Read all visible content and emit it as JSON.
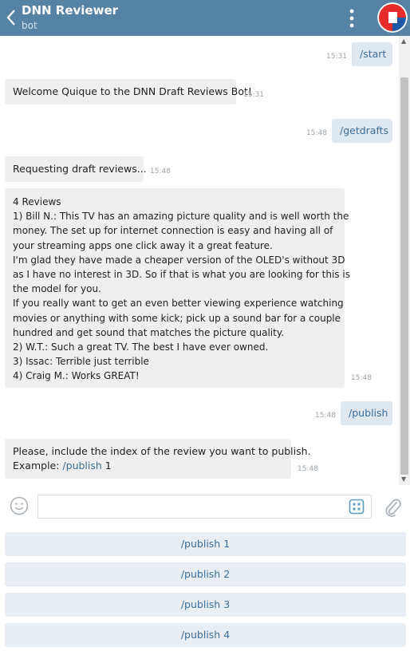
{
  "header": {
    "title": "DNN Reviewer",
    "subtitle": "bot"
  },
  "messages": [
    {
      "direction": "out",
      "text": "/start",
      "time": "15:31"
    },
    {
      "direction": "in",
      "text": "Welcome Quique to the DNN Draft Reviews Bot!",
      "time": "15:31"
    },
    {
      "direction": "out",
      "text": "/getdrafts",
      "time": "15:48"
    },
    {
      "direction": "in",
      "text": "Requesting draft reviews...",
      "time": "15:48"
    },
    {
      "direction": "in",
      "lines": [
        "4 Reviews",
        "1) Bill N.: This TV has an amazing picture quality and is well worth the",
        "money. The set up for internet connection is easy and having all of",
        "your streaming apps one click away it a great feature.",
        "I'm glad they have made a cheaper version of the OLED's without 3D",
        "as I have no interest in 3D. So if that is what you are looking for this is",
        "the model for you.",
        "If you really want to get an even better viewing experience watching",
        "movies or anything with some kick; pick up a sound bar for a couple",
        "hundred and get sound that matches the picture quality.",
        "2) W.T.: Such a great TV. The best I have ever owned.",
        "3) Issac: Terrible just terrible",
        "4) Craig M.: Works GREAT!"
      ],
      "time": "15:48"
    },
    {
      "direction": "out",
      "text": "/publish",
      "time": "15:48"
    },
    {
      "direction": "in",
      "line1": "Please, include the index of the review you want to publish.",
      "example_label": "Example: ",
      "example_cmd": "/publish",
      "example_arg": " 1",
      "time": "15:48"
    }
  ],
  "composer": {
    "placeholder": ""
  },
  "keyboard": [
    {
      "label": "/publish 1"
    },
    {
      "label": "/publish 2"
    },
    {
      "label": "/publish 3"
    },
    {
      "label": "/publish 4"
    }
  ],
  "colors": {
    "header_bg": "#5682a3",
    "outgoing_bubble": "#dfe8f1",
    "incoming_bubble": "#efefef",
    "link": "#3a6d99",
    "keyboard_button": "#e8eef3"
  },
  "icons": {
    "back": "chevron-left-icon",
    "menu": "more-vertical-icon",
    "emoji": "smile-icon",
    "keyboard": "bot-keyboard-icon",
    "attach": "paperclip-icon"
  }
}
